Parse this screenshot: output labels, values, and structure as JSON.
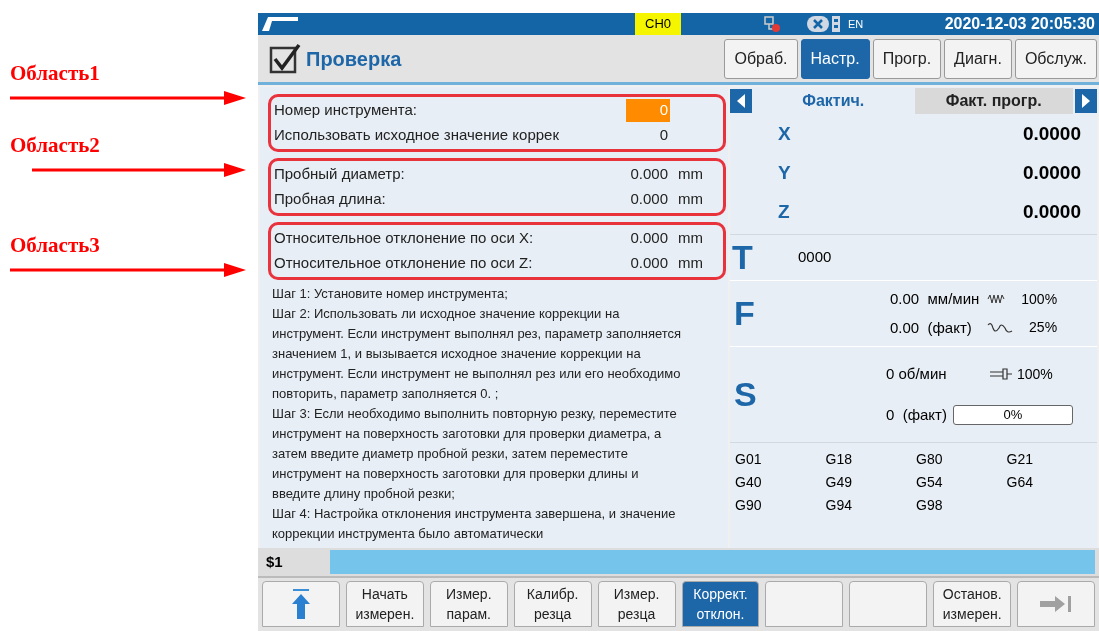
{
  "annotations": [
    {
      "label": "Область1"
    },
    {
      "label": "Область2"
    },
    {
      "label": "Область3"
    }
  ],
  "status_bar": {
    "channel": "CH0",
    "language": "EN",
    "datetime": "2020-12-03 20:05:30",
    "network_error": true
  },
  "header": {
    "title": "Проверка",
    "tabs": [
      {
        "label": "Обраб.",
        "selected": false
      },
      {
        "label": "Настр.",
        "selected": true
      },
      {
        "label": "Прогр.",
        "selected": false
      },
      {
        "label": "Диагн.",
        "selected": false
      },
      {
        "label": "Обслуж.",
        "selected": false
      }
    ]
  },
  "param_groups": [
    {
      "rows": [
        {
          "label": "Номер инструмента:",
          "value": "0",
          "unit": "",
          "focused": true
        },
        {
          "label": "Использовать исходное значение коррек",
          "value": "0",
          "unit": "",
          "focused": false
        }
      ]
    },
    {
      "rows": [
        {
          "label": "Пробный диаметр:",
          "value": "0.000",
          "unit": "mm",
          "focused": false
        },
        {
          "label": "Пробная длина:",
          "value": "0.000",
          "unit": "mm",
          "focused": false
        }
      ]
    },
    {
      "rows": [
        {
          "label": "Относительное отклонение по оси X:",
          "value": "0.000",
          "unit": "mm",
          "focused": false
        },
        {
          "label": "Относительное отклонение по оси Z:",
          "value": "0.000",
          "unit": "mm",
          "focused": false
        }
      ]
    }
  ],
  "instructions": [
    "Шаг 1: Установите номер инструмента;",
    "Шаг 2: Использовать ли исходное значение коррекции на инструмент. Если инструмент выполнял рез, параметр заполняется значением 1, и вызывается исходное значение коррекции на инструмент. Если инструмент не выполнял рез или его необходимо повторить, параметр заполняется 0. ;",
    "Шаг 3: Если необходимо выполнить повторную резку, переместите инструмент на поверхность заготовки для проверки диаметра, а затем введите диаметр пробной резки, затем переместите инструмент на поверхность заготовки для проверки длины и введите длину пробной резки;",
    "Шаг 4: Настройка отклонения инструмента завершена, и значение коррекции инструмента было автоматически"
  ],
  "coord_tabs": [
    {
      "label": "Фактич.",
      "selected": true
    },
    {
      "label": "Факт. прогр.",
      "selected": false
    }
  ],
  "axes": [
    {
      "name": "X",
      "value": "0.0000"
    },
    {
      "name": "Y",
      "value": "0.0000"
    },
    {
      "name": "Z",
      "value": "0.0000"
    }
  ],
  "tool": {
    "letter": "T",
    "value": "0000"
  },
  "feed": {
    "letter": "F",
    "rate": "0.00",
    "unit": "мм/мин",
    "override": "100%",
    "actual": "0.00",
    "actual_label": "(факт)",
    "rapid": "25%"
  },
  "spindle": {
    "letter": "S",
    "speed": "0",
    "unit": "об/мин",
    "override": "100%",
    "actual": "0",
    "actual_label": "(факт)",
    "load": "0%",
    "level": 0
  },
  "gcodes": [
    "G01",
    "G18",
    "G80",
    "G21",
    "G40",
    "G49",
    "G54",
    "G64",
    "G90",
    "G94",
    "G98"
  ],
  "command_line": {
    "prompt": "$1"
  },
  "softkeys": [
    {
      "kind": "up",
      "selected": false
    },
    {
      "kind": "text",
      "lines": [
        "Начать",
        "измерен."
      ],
      "selected": false
    },
    {
      "kind": "text",
      "lines": [
        "Измер.",
        "парам."
      ],
      "selected": false
    },
    {
      "kind": "text",
      "lines": [
        "Калибр.",
        "резца"
      ],
      "selected": false
    },
    {
      "kind": "text",
      "lines": [
        "Измер.",
        "резца"
      ],
      "selected": false
    },
    {
      "kind": "text",
      "lines": [
        "Коррект.",
        "отклон."
      ],
      "selected": true
    },
    {
      "kind": "blank",
      "selected": false
    },
    {
      "kind": "blank",
      "selected": false
    },
    {
      "kind": "text",
      "lines": [
        "Останов.",
        "измерен."
      ],
      "selected": false
    },
    {
      "kind": "next",
      "selected": false
    }
  ]
}
